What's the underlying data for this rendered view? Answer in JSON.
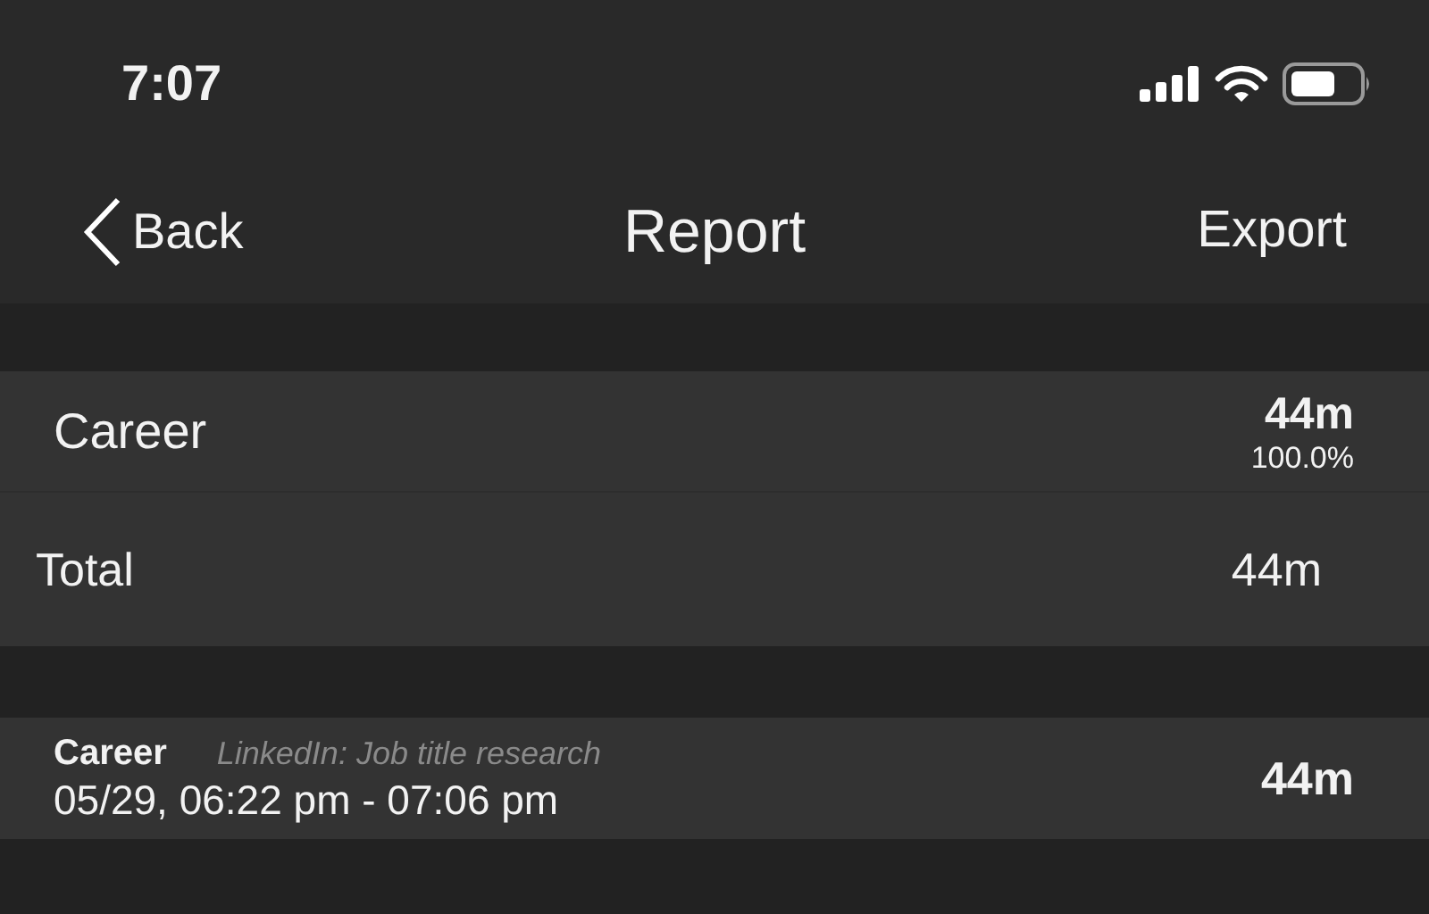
{
  "status_bar": {
    "time": "7:07"
  },
  "nav": {
    "back": "Back",
    "title": "Report",
    "action": "Export"
  },
  "summary": {
    "categories": [
      {
        "name": "Career",
        "duration": "44m",
        "percent": "100.0%"
      }
    ],
    "total": {
      "label": "Total",
      "duration": "44m"
    }
  },
  "entries": [
    {
      "category": "Career",
      "note": "LinkedIn: Job title research",
      "time_range": "05/29, 06:22 pm - 07:06 pm",
      "duration": "44m"
    }
  ]
}
